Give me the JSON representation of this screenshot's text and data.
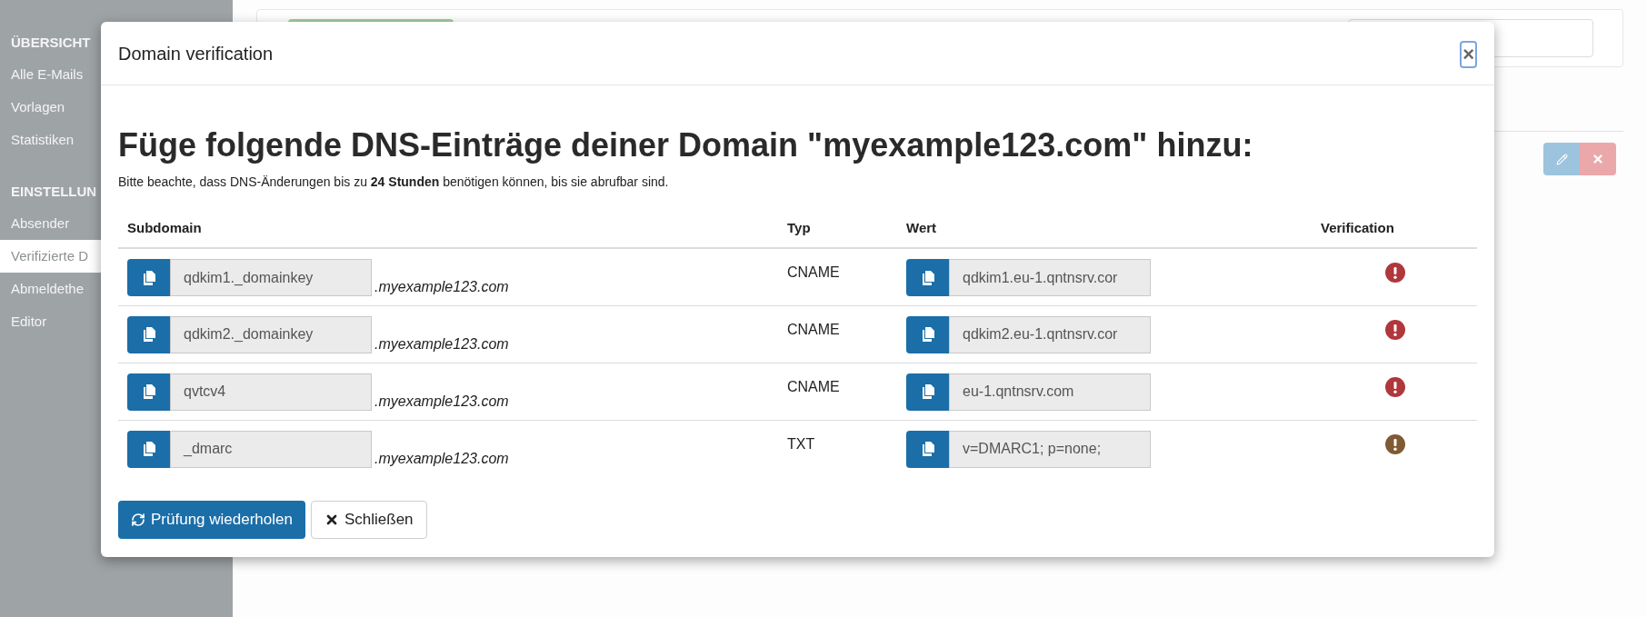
{
  "sidebar": {
    "sections": [
      {
        "heading": "ÜBERSICHT",
        "items": [
          {
            "label": "Alle E-Mails",
            "selected": false
          },
          {
            "label": "Vorlagen",
            "selected": false
          },
          {
            "label": "Statistiken",
            "selected": false
          }
        ]
      },
      {
        "heading": "EINSTELLUN",
        "items": [
          {
            "label": "Absender",
            "selected": false
          },
          {
            "label": "Verifizierte D",
            "selected": true
          },
          {
            "label": "Abmeldethe",
            "selected": false
          },
          {
            "label": "Editor",
            "selected": false
          }
        ]
      }
    ]
  },
  "modal": {
    "title": "Domain verification",
    "close": "×",
    "heading": "Füge folgende DNS-Einträge deiner Domain \"myexample123.com\" hinzu:",
    "note": "Bitte beachte, dass DNS-Änderungen bis zu **24 Stunden** benötigen können, bis sie abrufbar sind.",
    "columns": [
      "Subdomain",
      "Typ",
      "Wert",
      "Verification"
    ],
    "records": [
      {
        "subdomain": "qdkim1._domainkey",
        "suffix": ".myexample123.com",
        "type": "CNAME",
        "value": "qdkim1.eu-1.qntnsrv.cor",
        "color": "#b0373b"
      },
      {
        "subdomain": "qdkim2._domainkey",
        "suffix": ".myexample123.com",
        "type": "CNAME",
        "value": "qdkim2.eu-1.qntnsrv.cor",
        "color": "#b0373b"
      },
      {
        "subdomain": "qvtcv4",
        "suffix": ".myexample123.com",
        "type": "CNAME",
        "value": "eu-1.qntnsrv.com",
        "color": "#b0373b"
      },
      {
        "subdomain": "_dmarc",
        "suffix": ".myexample123.com",
        "type": "TXT",
        "value": "v=DMARC1; p=none;",
        "color": "#7f5a33"
      }
    ],
    "buttons": [
      {
        "label": "Prüfung wiederholen",
        "kind": "primary"
      },
      {
        "label": "Schließen",
        "kind": "default"
      }
    ]
  }
}
